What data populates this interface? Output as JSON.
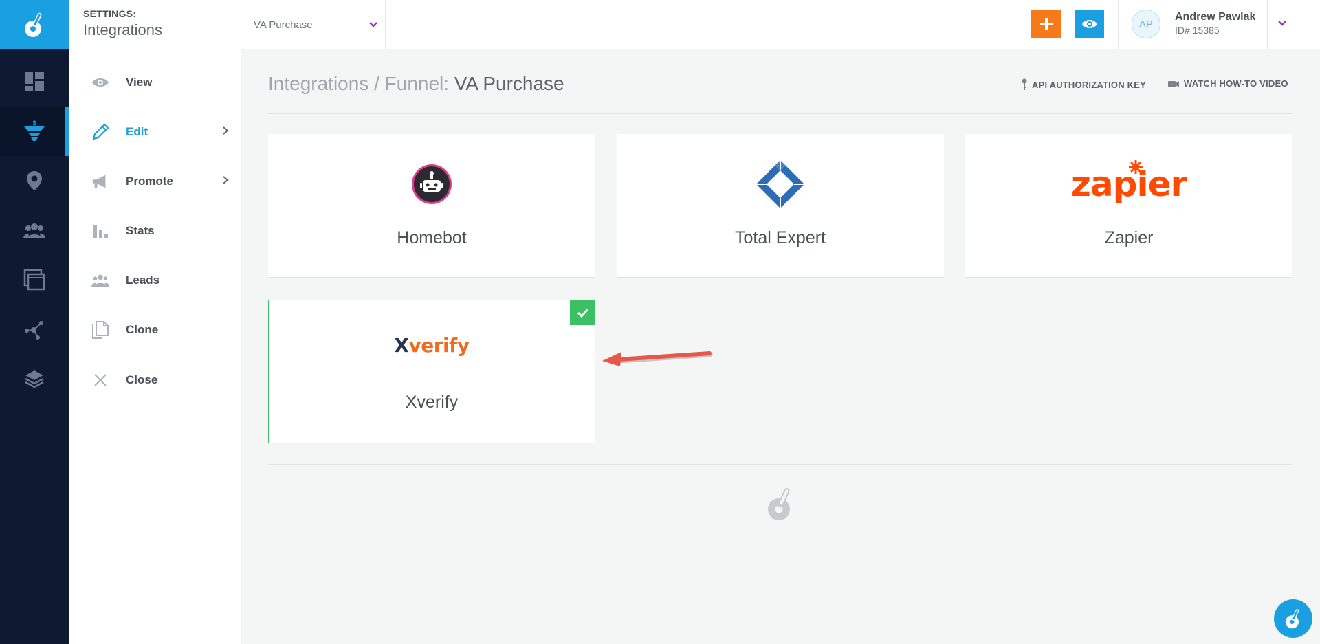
{
  "app": {
    "brand_color": "#1aa0e0",
    "accent_orange": "#f57a1a",
    "success_green": "#3cc064"
  },
  "rail": {
    "items": [
      {
        "icon": "dashboard-icon"
      },
      {
        "icon": "funnel-icon",
        "active": true
      },
      {
        "icon": "location-pin-icon"
      },
      {
        "icon": "contacts-icon"
      },
      {
        "icon": "pages-icon"
      },
      {
        "icon": "integrations-node-icon"
      },
      {
        "icon": "layers-icon"
      }
    ]
  },
  "settings": {
    "small_label": "SETTINGS:",
    "title": "Integrations",
    "menu": [
      {
        "label": "View",
        "icon": "eye-icon"
      },
      {
        "label": "Edit",
        "icon": "pencil-icon",
        "active": true,
        "has_submenu": true
      },
      {
        "label": "Promote",
        "icon": "megaphone-icon",
        "has_submenu": true
      },
      {
        "label": "Stats",
        "icon": "bar-chart-icon"
      },
      {
        "label": "Leads",
        "icon": "people-icon"
      },
      {
        "label": "Clone",
        "icon": "copy-icon"
      },
      {
        "label": "Close",
        "icon": "close-icon"
      }
    ]
  },
  "topbar": {
    "funnel_name": "VA Purchase",
    "user": {
      "initials": "AP",
      "name": "Andrew Pawlak",
      "id": "ID# 15385"
    }
  },
  "main": {
    "title_prefix": "Integrations / Funnel: ",
    "title_funnel": "VA Purchase",
    "api_link": "API AUTHORIZATION KEY",
    "video_link": "WATCH HOW-TO VIDEO",
    "integrations": [
      {
        "name": "Homebot",
        "selected": false,
        "icon": "homebot-logo"
      },
      {
        "name": "Total Expert",
        "selected": false,
        "icon": "total-expert-logo"
      },
      {
        "name": "Zapier",
        "selected": false,
        "icon": "zapier-logo",
        "logo_text": "zapier"
      },
      {
        "name": "Xverify",
        "selected": true,
        "icon": "xverify-logo",
        "logo_text_x": "X",
        "logo_text_rest": "verify"
      }
    ]
  }
}
